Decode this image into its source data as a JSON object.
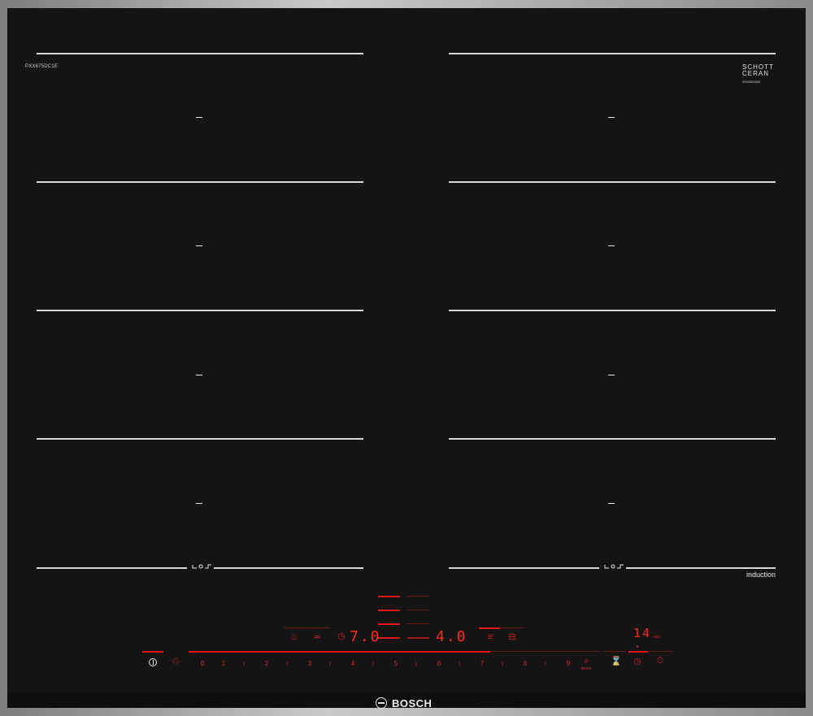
{
  "model_label": "PXX675DC1E",
  "glass_brand": {
    "line1": "SCHOTT",
    "line2": "CERAN",
    "code": "0000000000"
  },
  "induction_label": "induction",
  "brand_name": "BOSCH",
  "display": {
    "left_zone_value": "7.0",
    "right_zone_value": "4.0",
    "timer_value": "14",
    "timer_unit": "min"
  },
  "power_scale": [
    "0",
    "1",
    "2",
    "3",
    "4",
    "5",
    "6",
    "7",
    "8",
    "9"
  ],
  "boost_label": "boost",
  "colors": {
    "glass": "#141414",
    "accent_red": "#e0171b",
    "frame": "#b5b5b5"
  }
}
